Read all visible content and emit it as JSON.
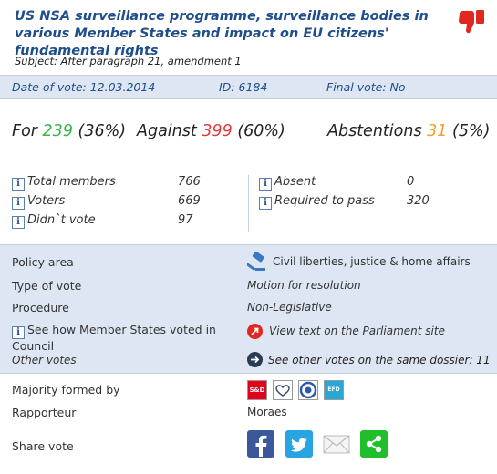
{
  "vote": {
    "title": "US NSA surveillance programme, surveillance bodies in various Member States and impact on EU citizens' fundamental rights",
    "subject": "Subject: After paragraph 21, amendment 1",
    "date": "Date of vote: 12.03.2014",
    "id": "ID: 6184",
    "final_vote": "Final vote: No"
  },
  "totals": {
    "for_label": "For",
    "for_count": "239",
    "for_pct": "(36%)",
    "against_label": "Against",
    "against_count": "399",
    "against_pct": "(60%)",
    "abst_label": "Abstentions",
    "abst_count": "31",
    "abst_pct": "(5%)"
  },
  "stats": {
    "total_members_label": "Total members",
    "total_members": "766",
    "voters_label": "Voters",
    "voters": "669",
    "didnt_vote_label": "Didn`t vote",
    "didnt_vote": "97",
    "absent_label": "Absent",
    "absent": "0",
    "required_label": "Required to pass",
    "required": "320"
  },
  "details": {
    "policy_label": "Policy area",
    "policy_value": "Civil liberties, justice & home affairs",
    "type_label": "Type of vote",
    "type_value": "Motion for resolution",
    "procedure_label": "Procedure",
    "procedure_value": "Non-Legislative",
    "member_states_link": "See how Member States voted in Council",
    "parliament_link": "View text on the Parliament site",
    "other_votes_label": "Other votes",
    "other_votes_link": "See other votes on the same dossier: 11"
  },
  "lower": {
    "majority_label": "Majority formed by",
    "rapporteur_label": "Rapporteur",
    "rapporteur_value": "Moraes",
    "share_label": "Share vote",
    "party_sd": "S&D",
    "party_efd": "EFD"
  },
  "colors": {
    "title_blue": "#1f4e8c",
    "bar_bg": "#dde6f2",
    "for_green": "#3ab54a",
    "against_red": "#e03a3a",
    "abst_orange": "#f0a030"
  },
  "icons": {
    "thumb": "thumbs-down-icon",
    "info": "info-icon",
    "gavel": "gavel-icon",
    "external": "external-link-icon",
    "arrow": "arrow-right-icon",
    "facebook": "facebook-icon",
    "twitter": "twitter-icon",
    "email": "email-icon",
    "share": "share-icon"
  }
}
